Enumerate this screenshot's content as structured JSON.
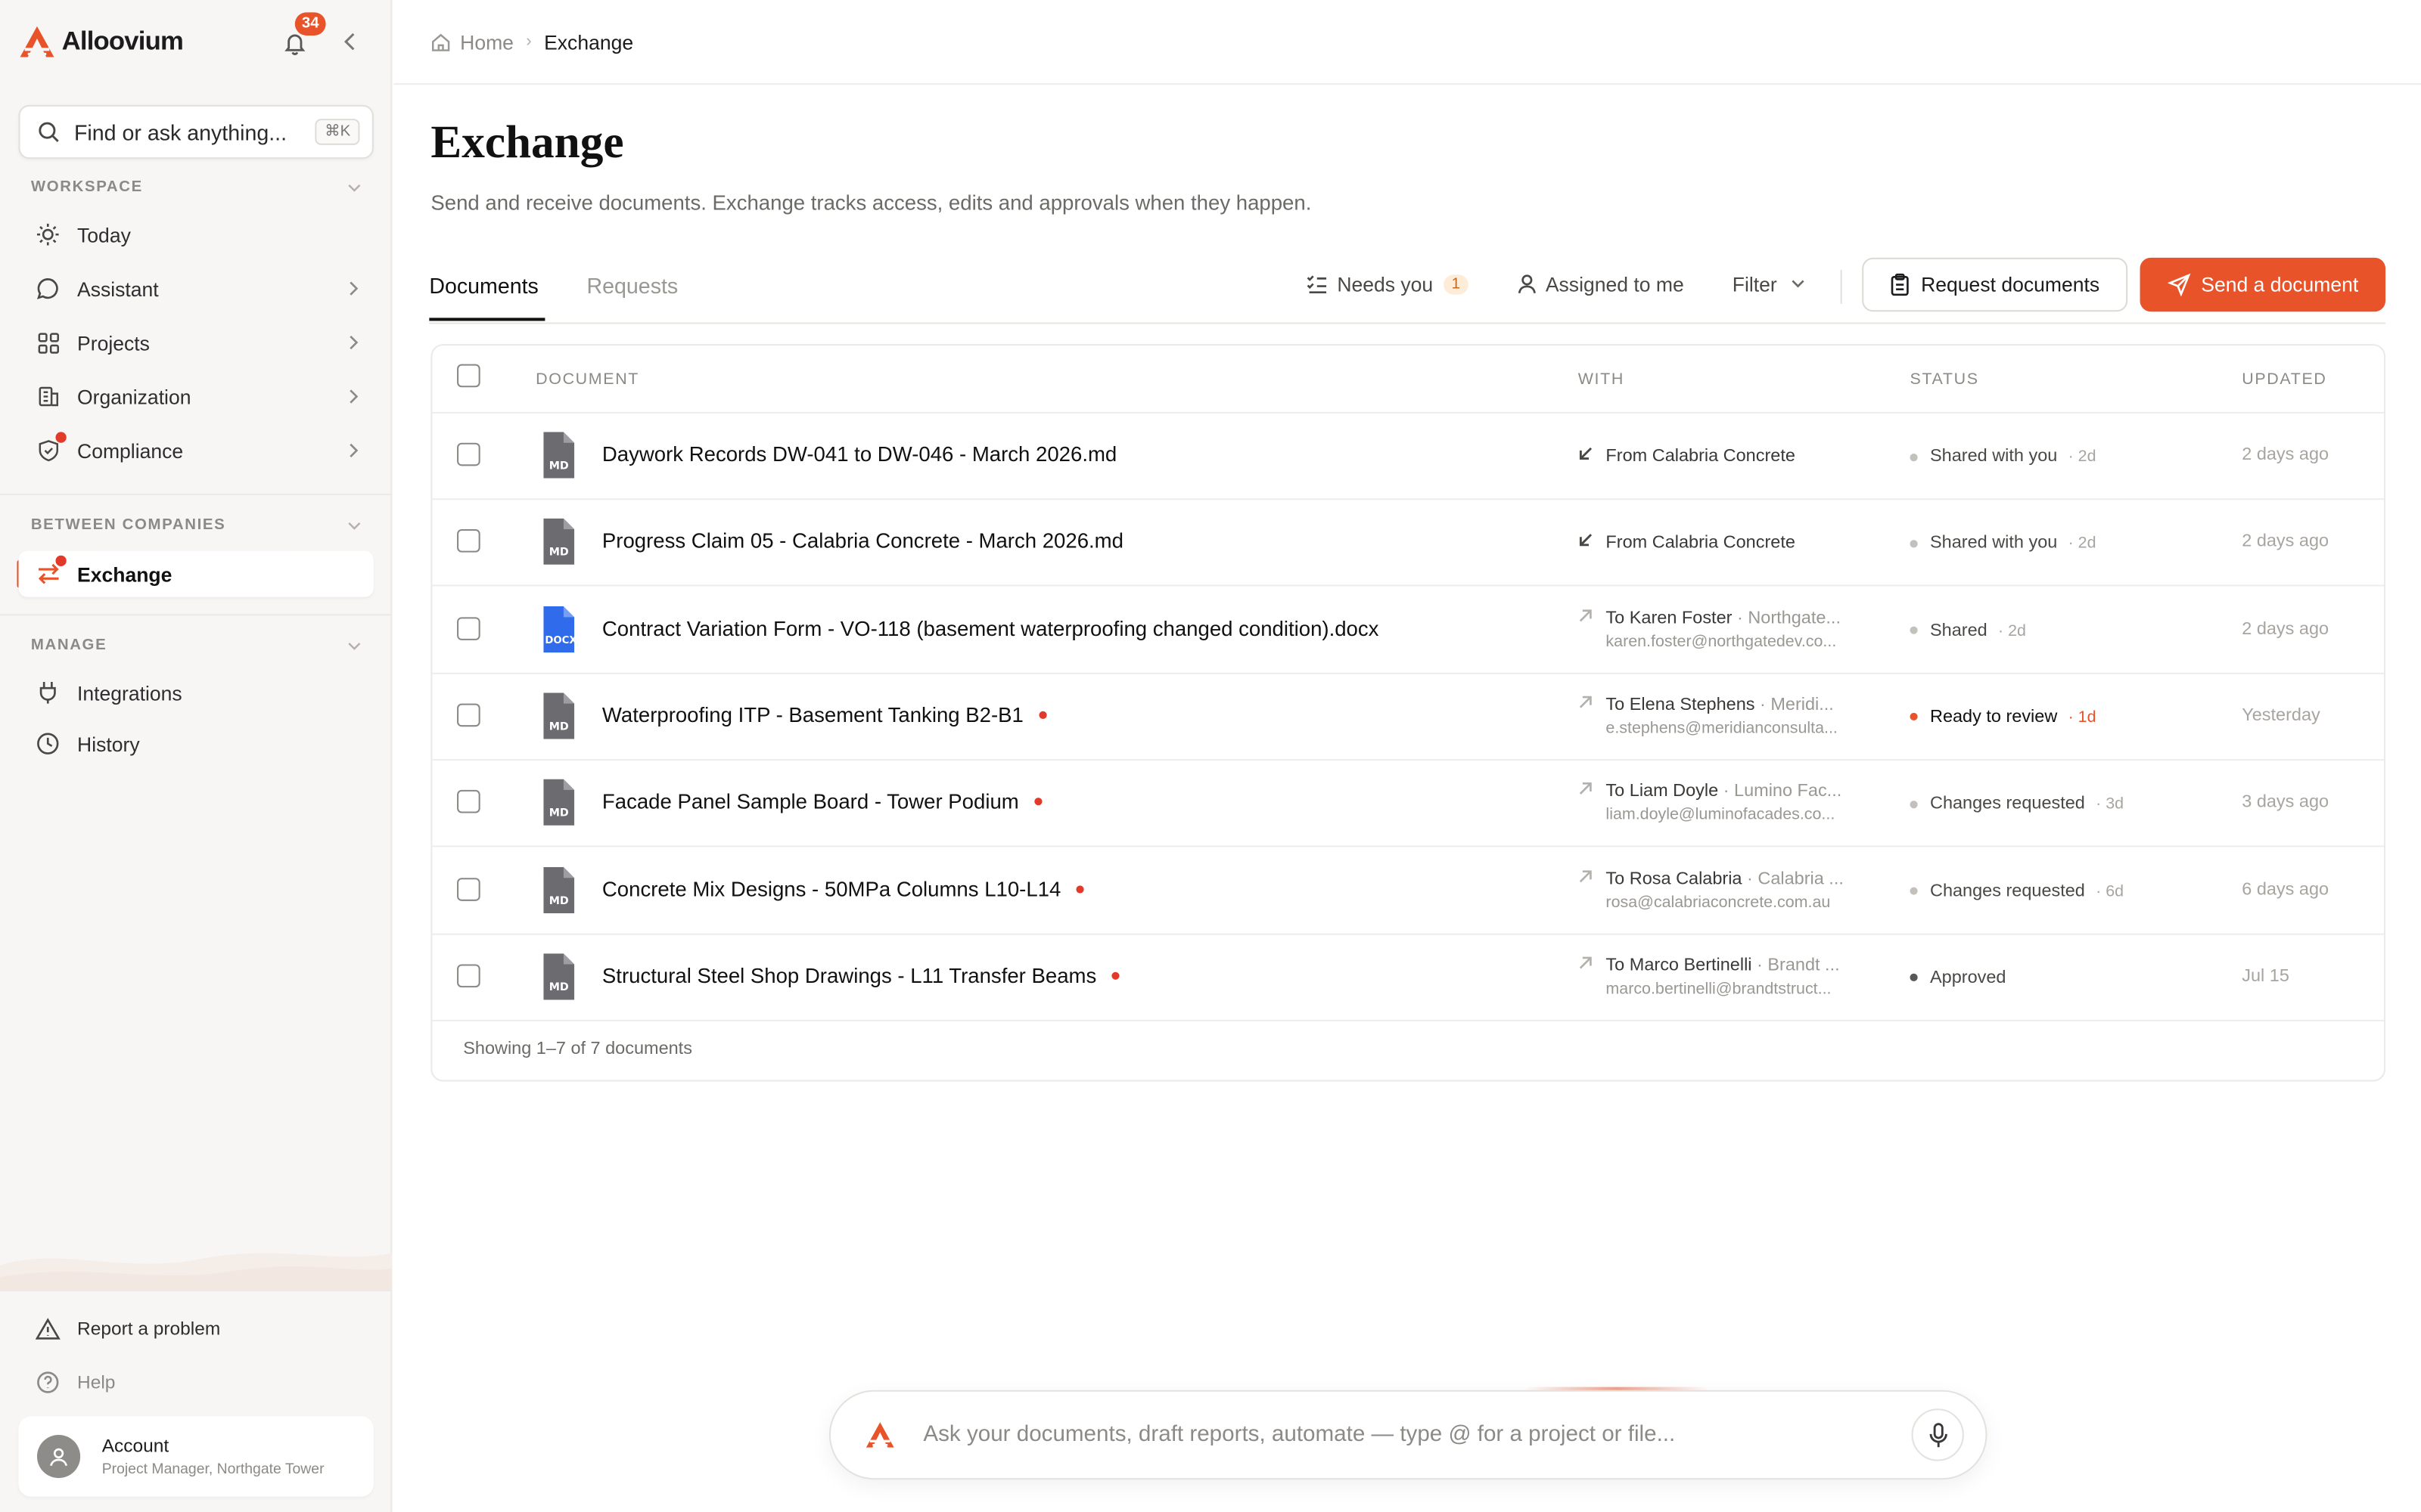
{
  "app": {
    "name": "Alloovium",
    "notifications": "34"
  },
  "search": {
    "placeholder": "Find or ask anything...",
    "shortcut": "⌘K"
  },
  "sidebar": {
    "workspace_title": "WORKSPACE",
    "workspace": [
      {
        "label": "Today",
        "icon": "sun-icon"
      },
      {
        "label": "Assistant",
        "icon": "chat-icon"
      },
      {
        "label": "Projects",
        "icon": "grid-icon"
      },
      {
        "label": "Organization",
        "icon": "building-icon"
      },
      {
        "label": "Compliance",
        "icon": "shield-icon"
      }
    ],
    "between_title": "BETWEEN COMPANIES",
    "exchange": "Exchange",
    "manage_title": "MANAGE",
    "manage": [
      {
        "label": "Integrations",
        "icon": "plug-icon"
      },
      {
        "label": "History",
        "icon": "clock-icon"
      }
    ],
    "report": "Report a problem",
    "help": "Help",
    "account": {
      "name": "Account",
      "role": "Project Manager, Northgate Tower"
    }
  },
  "breadcrumb": {
    "home": "Home",
    "current": "Exchange"
  },
  "page": {
    "title": "Exchange",
    "subtitle": "Send and receive documents. Exchange tracks access, edits and approvals when they happen."
  },
  "tabs": {
    "documents": "Documents",
    "requests": "Requests"
  },
  "toolbar": {
    "needs_you": "Needs you",
    "needs_count": "1",
    "assigned": "Assigned to me",
    "filter": "Filter",
    "request_docs": "Request documents",
    "send_doc": "Send a document"
  },
  "table": {
    "headers": {
      "document": "DOCUMENT",
      "with": "WITH",
      "status": "STATUS",
      "updated": "UPDATED"
    },
    "rows": [
      {
        "name": "Daywork Records DW-041 to DW-046 - March 2026.md",
        "type": "MD",
        "unread": false,
        "direction": "From",
        "party": "Calabria Concrete",
        "company": "",
        "email": "",
        "status": "Shared with you",
        "status_age": "· 2d",
        "updated": "2 days ago",
        "status_kind": "neutral"
      },
      {
        "name": "Progress Claim 05 - Calabria Concrete - March 2026.md",
        "type": "MD",
        "unread": false,
        "direction": "From",
        "party": "Calabria Concrete",
        "company": "",
        "email": "",
        "status": "Shared with you",
        "status_age": "· 2d",
        "updated": "2 days ago",
        "status_kind": "neutral"
      },
      {
        "name": "Contract Variation Form - VO-118 (basement waterproofing changed condition).docx",
        "type": "DOCX",
        "unread": false,
        "direction": "To",
        "party": "Karen Foster",
        "company": "· Northgate...",
        "email": "karen.foster@northgatedev.co...",
        "status": "Shared",
        "status_age": "· 2d",
        "updated": "2 days ago",
        "status_kind": "neutral"
      },
      {
        "name": "Waterproofing ITP - Basement Tanking B2-B1",
        "type": "MD",
        "unread": true,
        "direction": "To",
        "party": "Elena Stephens",
        "company": "· Meridi...",
        "email": "e.stephens@meridianconsulta...",
        "status": "Ready to review",
        "status_age": "· 1d",
        "updated": "Yesterday",
        "status_kind": "review"
      },
      {
        "name": "Facade Panel Sample Board - Tower Podium",
        "type": "MD",
        "unread": true,
        "direction": "To",
        "party": "Liam Doyle",
        "company": "· Lumino Fac...",
        "email": "liam.doyle@luminofacades.co...",
        "status": "Changes requested",
        "status_age": "· 3d",
        "updated": "3 days ago",
        "status_kind": "neutral"
      },
      {
        "name": "Concrete Mix Designs - 50MPa Columns L10-L14",
        "type": "MD",
        "unread": true,
        "direction": "To",
        "party": "Rosa Calabria",
        "company": "· Calabria ...",
        "email": "rosa@calabriaconcrete.com.au",
        "status": "Changes requested",
        "status_age": "· 6d",
        "updated": "6 days ago",
        "status_kind": "neutral"
      },
      {
        "name": "Structural Steel Shop Drawings - L11 Transfer Beams",
        "type": "MD",
        "unread": true,
        "direction": "To",
        "party": "Marco Bertinelli",
        "company": "· Brandt ...",
        "email": "marco.bertinelli@brandtstruct...",
        "status": "Approved",
        "status_age": "",
        "updated": "Jul 15",
        "status_kind": "approved"
      }
    ],
    "footer": "Showing 1–7 of 7 documents"
  },
  "ask": {
    "placeholder": "Ask your documents, draft reports, automate — type @ for a project or file..."
  },
  "colors": {
    "accent": "#e8532a",
    "docx": "#2f6bea",
    "md": "#6b6b70",
    "unread": "#e23a2a"
  }
}
